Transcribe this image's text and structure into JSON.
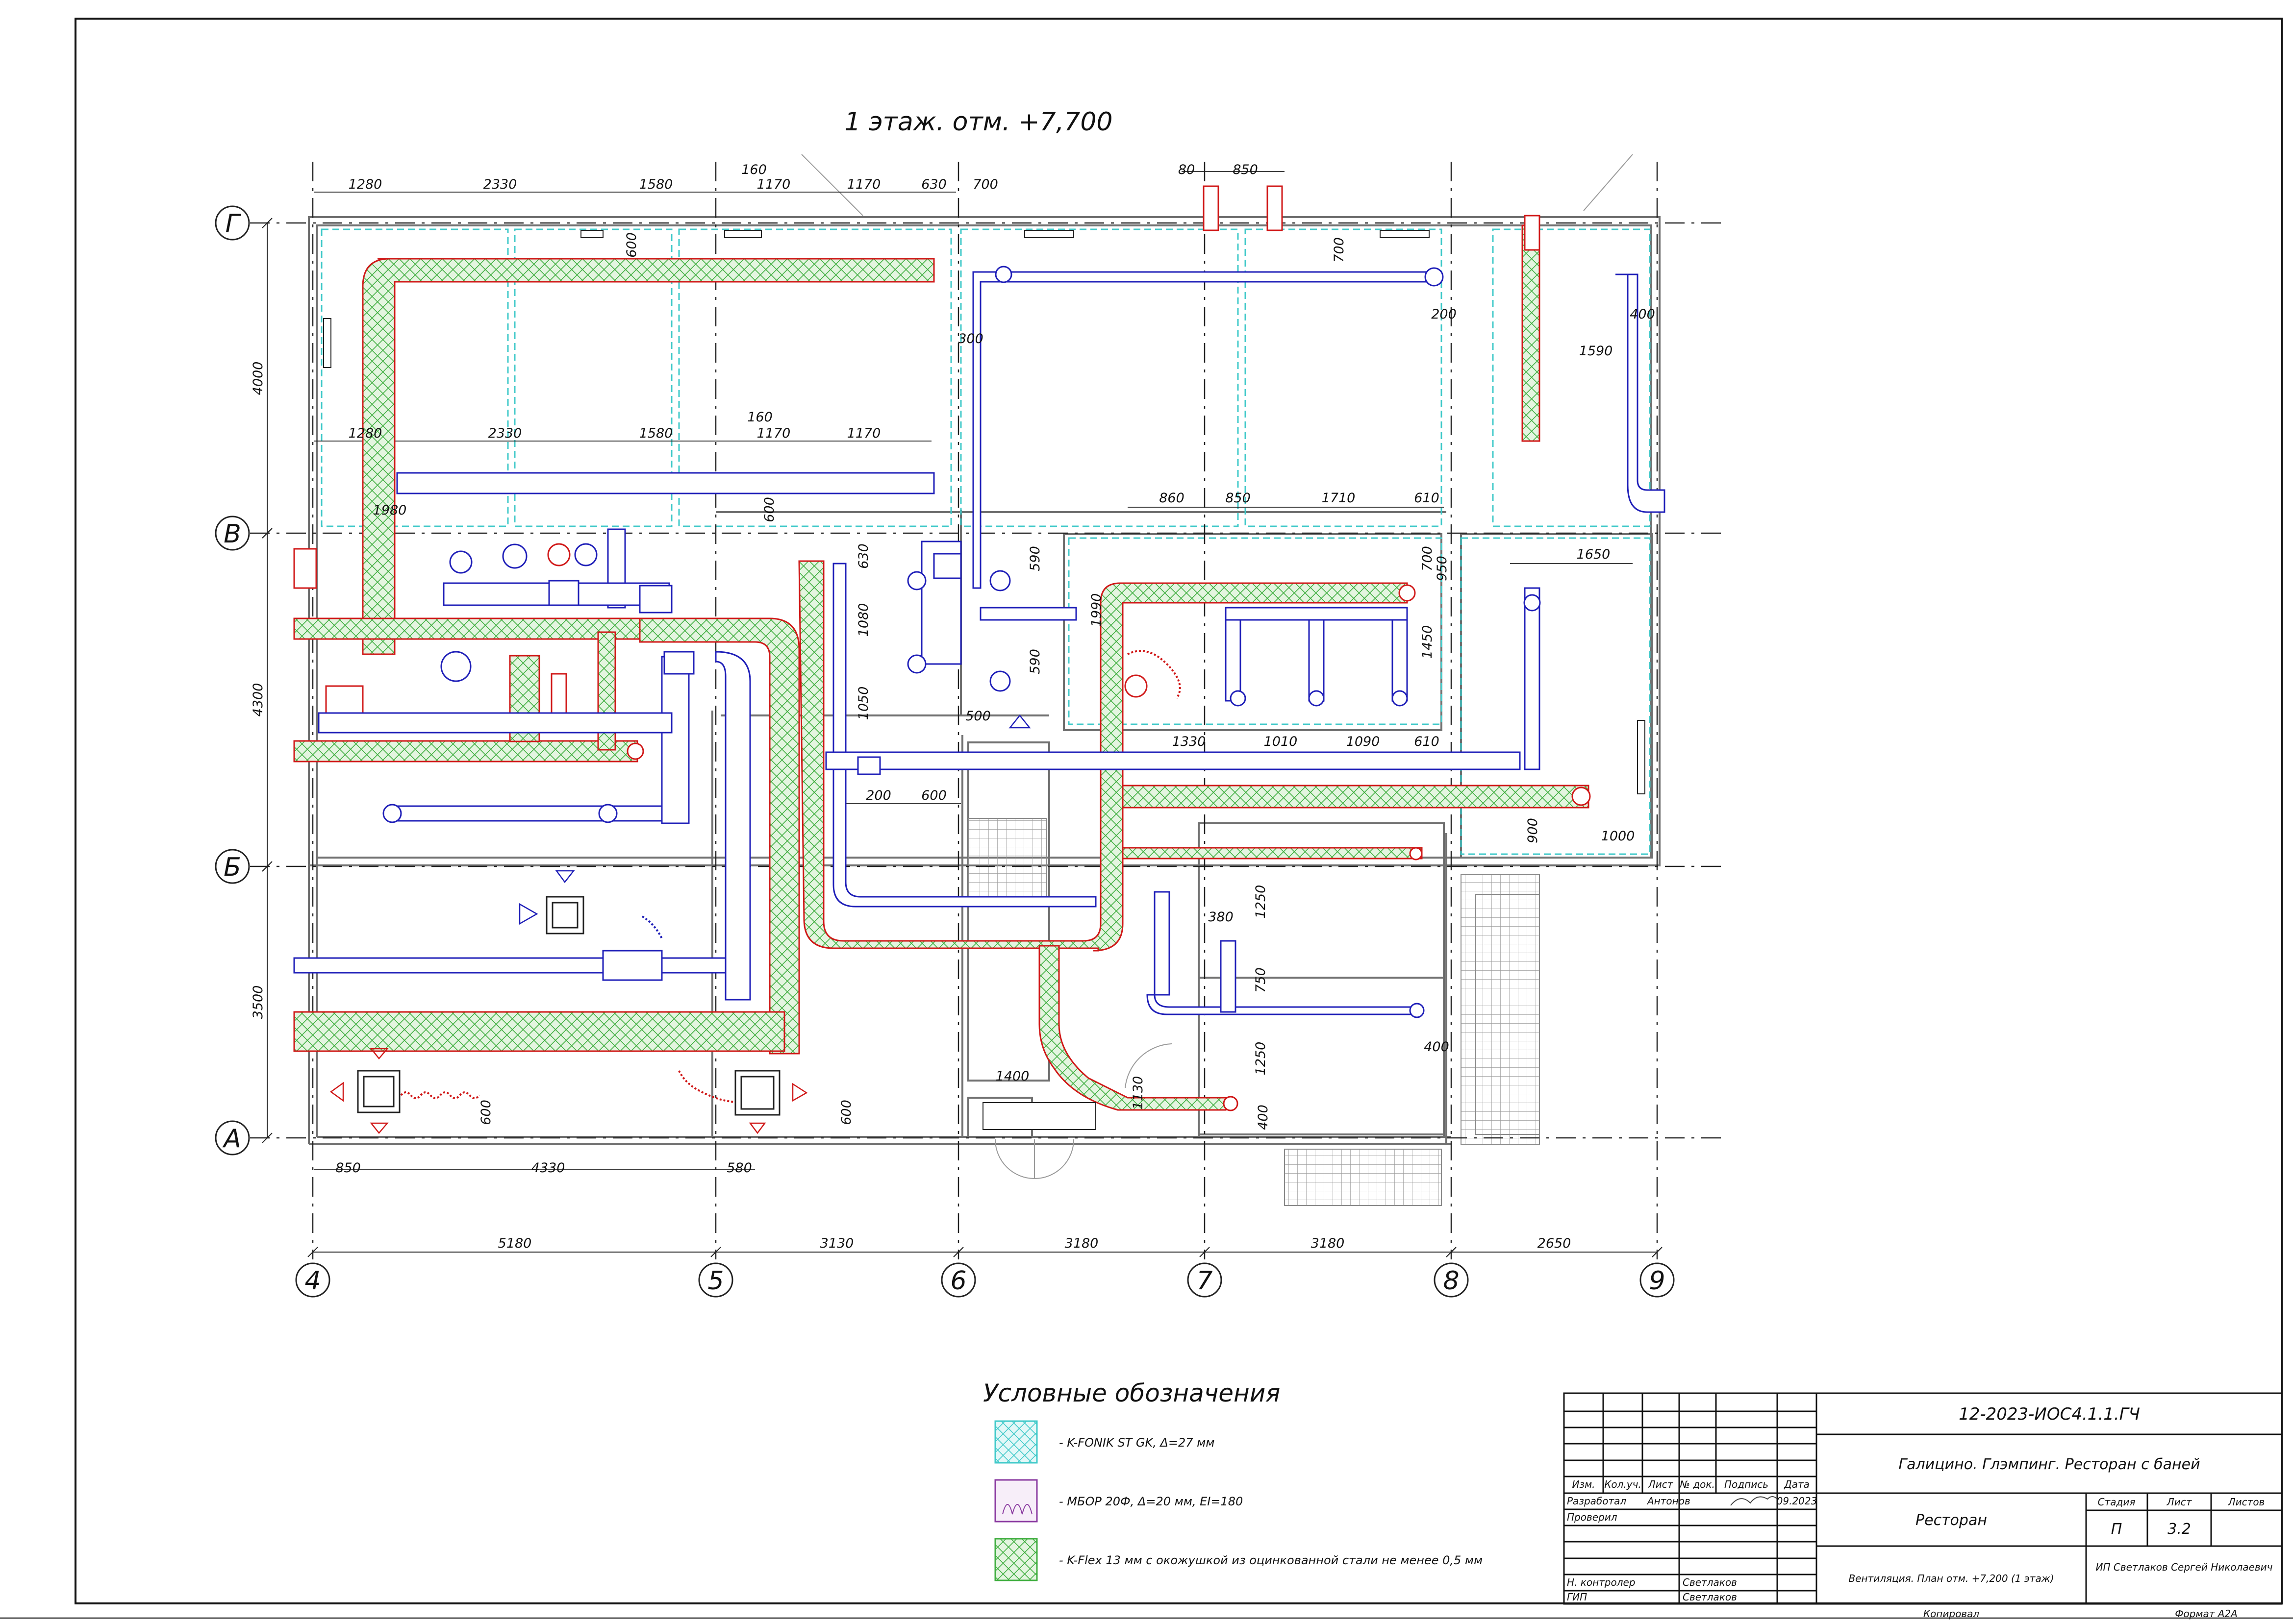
{
  "sheet": {
    "title": "1 этаж. отм. +7,700",
    "format": "Формат А2А",
    "copied": "Копировал"
  },
  "grid": {
    "rows": [
      {
        "label": "Г"
      },
      {
        "label": "В"
      },
      {
        "label": "Б"
      },
      {
        "label": "А"
      }
    ],
    "columns": [
      {
        "label": "4"
      },
      {
        "label": "5"
      },
      {
        "label": "6"
      },
      {
        "label": "7"
      },
      {
        "label": "8"
      },
      {
        "label": "9"
      }
    ],
    "column_spans": [
      "5180",
      "3130",
      "3180",
      "3180",
      "2650"
    ],
    "row_spans": [
      "4000",
      "4300",
      "3500"
    ]
  },
  "dimensions": {
    "top_row_1": [
      "1280",
      "2330",
      "1580",
      "160",
      "1170",
      "1170",
      "630",
      "700",
      "80",
      "850"
    ],
    "top_row_2": [
      "1280",
      "2330",
      "1580",
      "160",
      "1170",
      "1170"
    ],
    "upper_right": [
      "700",
      "200",
      "300",
      "400",
      "1590",
      "600",
      "600"
    ],
    "middle_band": [
      "860",
      "850",
      "1710",
      "610",
      "700",
      "1450",
      "950",
      "1650",
      "1990",
      "1980",
      "630",
      "590",
      "590",
      "1080",
      "1050",
      "500"
    ],
    "middle_lower": [
      "1330",
      "1010",
      "1090",
      "610",
      "200",
      "600",
      "900",
      "1000"
    ],
    "lower_band": [
      "380",
      "1250",
      "750",
      "1250",
      "400",
      "400",
      "1130",
      "1400"
    ],
    "bottom_row": [
      "850",
      "4330",
      "580",
      "600",
      "600"
    ]
  },
  "legend": {
    "title": "Условные обозначения",
    "items": [
      {
        "swatch": "cyan-crosshatch",
        "text": "- K-FONIK ST GK, Δ=27 мм"
      },
      {
        "swatch": "purple-wave",
        "text": "- МБОР 20Ф, Δ=20 мм, EI=180"
      },
      {
        "swatch": "green-crosshatch",
        "text": "- K-Flex 13 мм с окожушкой из оцинкованной стали не менее 0,5 мм"
      }
    ]
  },
  "stamp": {
    "code": "12-2023-ИОС4.1.1.ГЧ",
    "project": "Галицино. Глэмпинг.  Ресторан с баней",
    "object": "Ресторан",
    "sheet_name": "Вентиляция. План отм. +7,200 (1 этаж)",
    "company": "ИП Светлаков Сергей Николаевич",
    "header_cols": [
      "Изм.",
      "Кол.уч.",
      "Лист",
      "№ док.",
      "Подпись",
      "Дата"
    ],
    "roles": [
      {
        "role": "Разработал",
        "name": "Антонов",
        "date": "09.2023"
      },
      {
        "role": "Проверил",
        "name": "",
        "date": ""
      },
      {
        "role": "",
        "name": "",
        "date": ""
      },
      {
        "role": "",
        "name": "",
        "date": ""
      },
      {
        "role": "Н. контролер",
        "name": "Светлаков",
        "date": ""
      },
      {
        "role": "ГИП",
        "name": "Светлаков",
        "date": ""
      }
    ],
    "stage_header": "Стадия",
    "sheet_header": "Лист",
    "sheets_header": "Листов",
    "stage": "П",
    "sheet": "3.2",
    "sheets": ""
  },
  "colors": {
    "supply": "#d01818",
    "exhaust": "#1f1fb8",
    "insulation_green": "#3fae3f",
    "insulation_cyan": "#3fc9c9",
    "wall": "#707070",
    "axis": "#222222"
  }
}
